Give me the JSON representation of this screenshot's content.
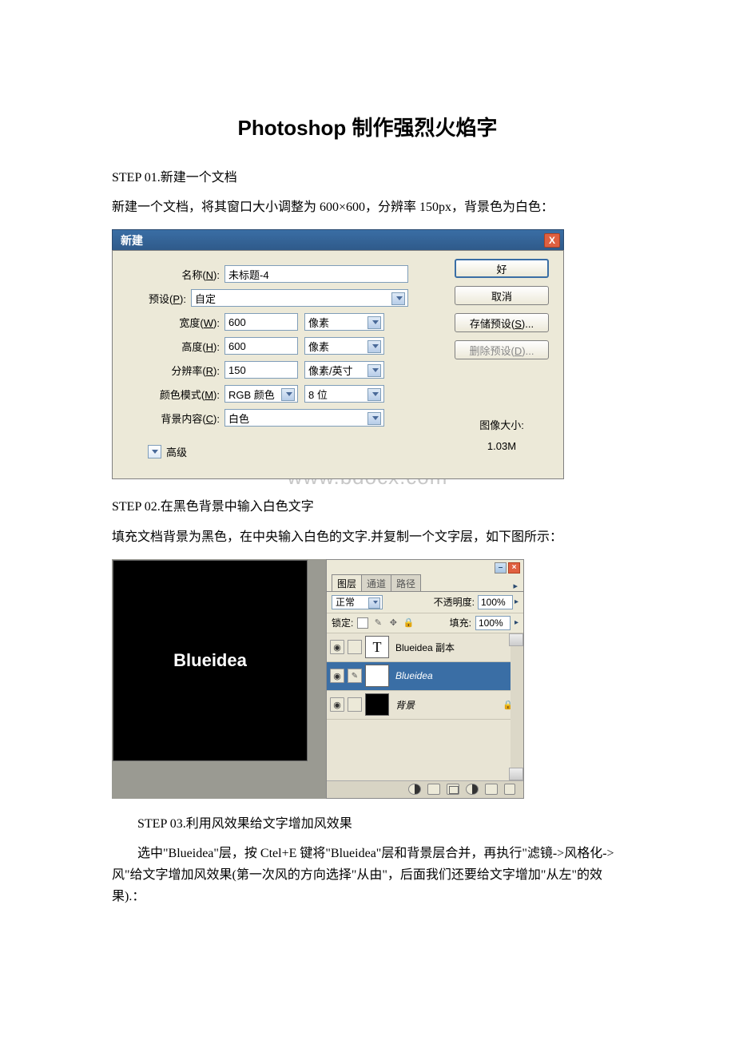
{
  "title": "Photoshop 制作强烈火焰字",
  "step1": {
    "heading": "STEP 01.新建一个文档",
    "text": "新建一个文档，将其窗口大小调整为 600×600，分辨率 150px，背景色为白色："
  },
  "dialog_new": {
    "titlebar": "新建",
    "close": "X",
    "labels": {
      "name": "名称(N):",
      "preset": "预设(P):",
      "width": "宽度(W):",
      "height": "高度(H):",
      "resolution": "分辨率(R):",
      "color_mode": "颜色模式(M):",
      "bg_content": "背景内容(C):",
      "advanced": "高级"
    },
    "values": {
      "name": "未标题-4",
      "preset": "自定",
      "width": "600",
      "height": "600",
      "resolution": "150",
      "color_mode": "RGB 颜色",
      "bit_depth": "8 位",
      "bg_content": "白色",
      "width_unit": "像素",
      "height_unit": "像素",
      "resolution_unit": "像素/英寸"
    },
    "buttons": {
      "ok": "好",
      "cancel": "取消",
      "save_preset": "存储预设(S)...",
      "delete_preset": "删除预设(D)..."
    },
    "image_size_label": "图像大小:",
    "image_size_value": "1.03M"
  },
  "watermark": "www.bdocx.com",
  "step2": {
    "heading": "STEP 02.在黑色背景中输入白色文字",
    "text": "填充文档背景为黑色，在中央输入白色的文字.并复制一个文字层，如下图所示："
  },
  "canvas_text": "Blueidea",
  "layers_panel": {
    "tabs": {
      "layers": "图层",
      "channels": "通道",
      "paths": "路径"
    },
    "blend_mode": "正常",
    "opacity_label": "不透明度:",
    "opacity_value": "100%",
    "lock_label": "锁定:",
    "fill_label": "填充:",
    "fill_value": "100%",
    "layers": [
      {
        "name": "Blueidea 副本",
        "type": "T"
      },
      {
        "name": "Blueidea",
        "type": "T"
      },
      {
        "name": "背景",
        "type": "bg"
      }
    ]
  },
  "step3": {
    "heading": "STEP 03.利用风效果给文字增加风效果",
    "text": "选中\"Blueidea\"层，按 Ctel+E 键将\"Blueidea\"层和背景层合并，再执行\"滤镜->风格化->风\"给文字增加风效果(第一次风的方向选择\"从由\"，后面我们还要给文字增加\"从左\"的效果).："
  }
}
